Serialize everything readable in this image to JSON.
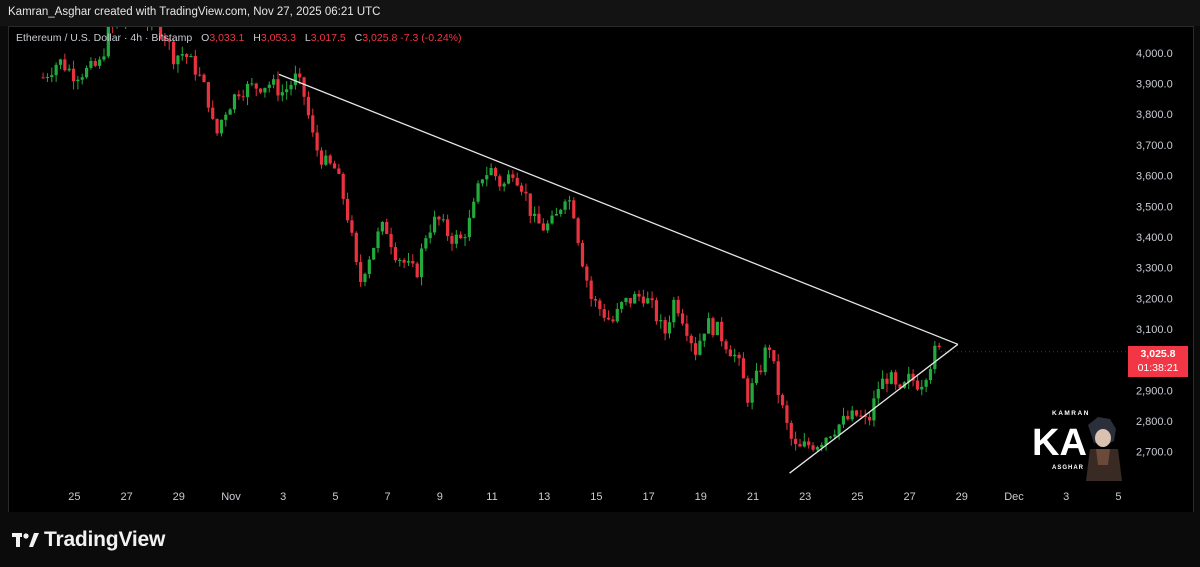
{
  "header": {
    "credit": "Kamran_Asghar created with TradingView.com, Nov 27, 2025 06:21 UTC"
  },
  "legend": {
    "symbol": "Ethereum / U.S. Dollar · 4h · Bitstamp",
    "open_label": "O",
    "open": "3,033.1",
    "high_label": "H",
    "high": "3,053.3",
    "low_label": "L",
    "low": "3,017.5",
    "close_label": "C",
    "close": "3,025.8",
    "change": "-7.3 (-0.24%)"
  },
  "price_tag": {
    "price": "3,025.8",
    "countdown": "01:38:21"
  },
  "watermark": {
    "top": "KAMRAN",
    "letters": "KA",
    "bottom": "ASGHAR"
  },
  "footer": {
    "brand": "TradingView"
  },
  "colors": {
    "up": "#22ab3c",
    "down": "#e8323f",
    "trendline": "#e6e6e6",
    "tag": "#f23645"
  },
  "chart_data": {
    "type": "candlestick",
    "title": "Ethereum / U.S. Dollar · 4h · Bitstamp",
    "ylim": [
      2620,
      4100
    ],
    "y_ticks": [
      2700,
      2800,
      2900,
      3000,
      3100,
      3200,
      3300,
      3400,
      3500,
      3600,
      3700,
      3800,
      3900,
      4000
    ],
    "y_tick_labels": [
      "2,700.0",
      "2,800.0",
      "2,900.0",
      "3,000.0",
      "3,100.0",
      "3,200.0",
      "3,300.0",
      "3,400.0",
      "3,500.0",
      "3,600.0",
      "3,700.0",
      "3,800.0",
      "3,900.0",
      "4,000.0"
    ],
    "x_tick_labels": [
      "25",
      "27",
      "29",
      "Nov",
      "3",
      "5",
      "7",
      "9",
      "11",
      "13",
      "15",
      "17",
      "19",
      "21",
      "23",
      "25",
      "27",
      "29",
      "Dec",
      "3",
      "5"
    ],
    "x_tick_days": [
      -6,
      -4,
      -2,
      0,
      2,
      4,
      6,
      8,
      10,
      12,
      14,
      16,
      18,
      20,
      22,
      24,
      26,
      28,
      30,
      32,
      34
    ],
    "close_path": [
      [
        -7.2,
        3920
      ],
      [
        -6.6,
        3975
      ],
      [
        -6.0,
        3930
      ],
      [
        -5.4,
        3945
      ],
      [
        -5.0,
        3965
      ],
      [
        -4.7,
        4070
      ],
      [
        -4.0,
        4110
      ],
      [
        -3.0,
        4110
      ],
      [
        -2.6,
        4070
      ],
      [
        -2.2,
        3990
      ],
      [
        -1.8,
        4000
      ],
      [
        -1.3,
        3940
      ],
      [
        -0.9,
        3860
      ],
      [
        -0.6,
        3720
      ],
      [
        -0.3,
        3800
      ],
      [
        0.3,
        3880
      ],
      [
        0.9,
        3890
      ],
      [
        1.5,
        3900
      ],
      [
        2.0,
        3870
      ],
      [
        2.5,
        3920
      ],
      [
        2.8,
        3860
      ],
      [
        3.2,
        3700
      ],
      [
        3.6,
        3640
      ],
      [
        4.0,
        3620
      ],
      [
        4.4,
        3500
      ],
      [
        4.7,
        3360
      ],
      [
        4.9,
        3240
      ],
      [
        5.2,
        3320
      ],
      [
        5.6,
        3400
      ],
      [
        5.9,
        3440
      ],
      [
        6.3,
        3350
      ],
      [
        6.8,
        3300
      ],
      [
        7.1,
        3280
      ],
      [
        7.5,
        3420
      ],
      [
        7.9,
        3460
      ],
      [
        8.4,
        3400
      ],
      [
        8.8,
        3390
      ],
      [
        9.2,
        3460
      ],
      [
        9.6,
        3600
      ],
      [
        10.0,
        3620
      ],
      [
        10.4,
        3560
      ],
      [
        10.8,
        3620
      ],
      [
        11.2,
        3560
      ],
      [
        11.6,
        3450
      ],
      [
        12.0,
        3430
      ],
      [
        12.4,
        3450
      ],
      [
        12.8,
        3540
      ],
      [
        13.1,
        3500
      ],
      [
        13.4,
        3350
      ],
      [
        13.8,
        3200
      ],
      [
        14.2,
        3160
      ],
      [
        14.6,
        3120
      ],
      [
        15.0,
        3180
      ],
      [
        15.4,
        3200
      ],
      [
        15.8,
        3210
      ],
      [
        16.2,
        3160
      ],
      [
        16.6,
        3080
      ],
      [
        17.0,
        3200
      ],
      [
        17.4,
        3120
      ],
      [
        17.8,
        3030
      ],
      [
        18.2,
        3120
      ],
      [
        18.6,
        3100
      ],
      [
        19.0,
        3050
      ],
      [
        19.4,
        3000
      ],
      [
        19.8,
        2880
      ],
      [
        20.2,
        2950
      ],
      [
        20.6,
        3060
      ],
      [
        21.0,
        2880
      ],
      [
        21.4,
        2750
      ],
      [
        21.7,
        2700
      ],
      [
        22.0,
        2720
      ],
      [
        22.5,
        2730
      ],
      [
        23.0,
        2770
      ],
      [
        23.5,
        2800
      ],
      [
        24.0,
        2820
      ],
      [
        24.4,
        2790
      ],
      [
        24.8,
        2910
      ],
      [
        25.2,
        2950
      ],
      [
        25.6,
        2880
      ],
      [
        26.0,
        2940
      ],
      [
        26.4,
        2920
      ],
      [
        26.8,
        2990
      ],
      [
        27.0,
        3030
      ],
      [
        27.2,
        3025
      ]
    ],
    "trendlines": [
      {
        "name": "resistance",
        "x": [
          1.84,
          27.85
        ],
        "y": [
          3930,
          3050
        ]
      },
      {
        "name": "support",
        "x": [
          21.4,
          27.85
        ],
        "y": [
          2630,
          3050
        ]
      }
    ],
    "last_price": 3025.8
  }
}
